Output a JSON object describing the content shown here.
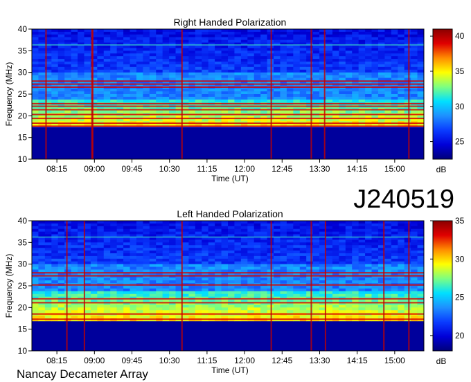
{
  "main_title": "J240519",
  "footer": "Nancay Decameter Array",
  "colors": {
    "colormap": [
      "#00007a",
      "#0000d8",
      "#0a3cff",
      "#1e90ff",
      "#00e0ff",
      "#7dff80",
      "#ffff00",
      "#ff8c00",
      "#e00000",
      "#8a0000"
    ],
    "axis": "#000000"
  },
  "chart_data": [
    {
      "type": "heatmap",
      "title": "Right Handed Polarization",
      "xlabel": "Time (UT)",
      "ylabel": "Frequency (MHz)",
      "xlim": [
        "07:45",
        "15:35"
      ],
      "ylim": [
        10,
        40
      ],
      "xticks": [
        "08:15",
        "09:00",
        "09:45",
        "10:30",
        "11:15",
        "12:00",
        "12:45",
        "13:30",
        "14:15",
        "15:00"
      ],
      "yticks": [
        "10",
        "15",
        "20",
        "25",
        "30",
        "35",
        "40"
      ],
      "colorbar": {
        "label": "dB",
        "ticks": [
          "25",
          "30",
          "35",
          "40"
        ],
        "range": [
          22.5,
          41
        ]
      },
      "features": {
        "background_cutoff_mhz": 17.3,
        "bright_bands_mhz": [
          17.6,
          18.3,
          19.4,
          20.3,
          21.4,
          22.2,
          22.8,
          26.6,
          27.3,
          28.0
        ],
        "vertical_lines_ut": [
          "08:02",
          "08:57",
          "08:58",
          "10:45",
          "12:32",
          "13:20",
          "13:36",
          "15:17"
        ],
        "faint_band_mhz": 36.3
      }
    },
    {
      "type": "heatmap",
      "title": "Left Handed Polarization",
      "xlabel": "Time (UT)",
      "ylabel": "Frequency (MHz)",
      "xlim": [
        "07:45",
        "15:35"
      ],
      "ylim": [
        10,
        40
      ],
      "xticks": [
        "08:15",
        "09:00",
        "09:45",
        "10:30",
        "11:15",
        "12:00",
        "12:45",
        "13:30",
        "14:15",
        "15:00"
      ],
      "yticks": [
        "10",
        "15",
        "20",
        "25",
        "30",
        "35",
        "40"
      ],
      "colorbar": {
        "label": "dB",
        "ticks": [
          "20",
          "25",
          "30",
          "35"
        ],
        "range": [
          18,
          35
        ]
      },
      "features": {
        "background_cutoff_mhz": 17.0,
        "bright_bands_mhz": [
          17.3,
          18.5,
          21.1,
          22.0,
          25.2,
          27.3,
          28.0
        ],
        "vertical_lines_ut": [
          "08:27",
          "08:48",
          "10:45",
          "12:32",
          "13:20",
          "13:37",
          "14:47",
          "15:17"
        ],
        "faint_band_mhz": 36.2
      }
    }
  ]
}
